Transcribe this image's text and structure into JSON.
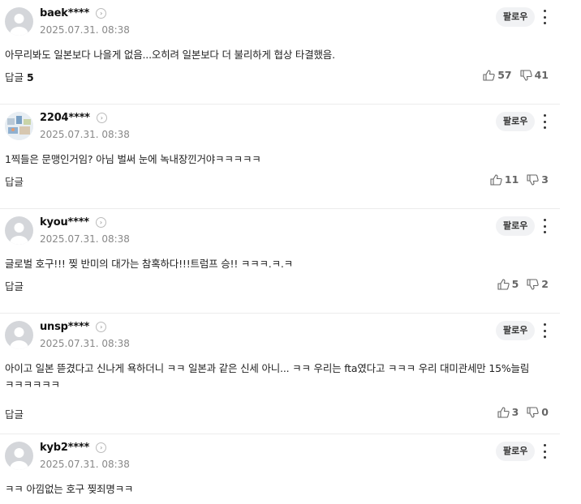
{
  "comments": [
    {
      "author": "baek****",
      "date": "2025.07.31. 08:38",
      "follow_label": "팔로우",
      "text": "아무리봐도 일본보다 나을게 없음...오히려 일본보다 더 불리하게 협상 타결했음.",
      "reply_label": "답글",
      "reply_count": "5",
      "likes": "57",
      "dislikes": "41"
    },
    {
      "author": "2204****",
      "date": "2025.07.31. 08:38",
      "follow_label": "팔로우",
      "text": "1찍들은 문맹인거임? 아님 벌써 눈에 녹내장낀거야ㅋㅋㅋㅋㅋ",
      "reply_label": "답글",
      "reply_count": "",
      "likes": "11",
      "dislikes": "3"
    },
    {
      "author": "kyou****",
      "date": "2025.07.31. 08:38",
      "follow_label": "팔로우",
      "text": "글로벌 호구!!! 찢 반미의 대가는 참혹하다!!!트럼프 승!! ㅋㅋㅋ.ㅋ.ㅋ",
      "reply_label": "답글",
      "reply_count": "",
      "likes": "5",
      "dislikes": "2"
    },
    {
      "author": "unsp****",
      "date": "2025.07.31. 08:38",
      "follow_label": "팔로우",
      "text": "아이고 일본 뜯겼다고 신나게 욕하더니 ㅋㅋ 일본과 같은 신세 아니... ㅋㅋ 우리는 fta였다고 ㅋㅋㅋ 우리 대미관세만 15%늘림ㅋㅋㅋㅋㅋㅋ",
      "reply_label": "답글",
      "reply_count": "",
      "likes": "3",
      "dislikes": "0"
    },
    {
      "author": "kyb2****",
      "date": "2025.07.31. 08:38",
      "follow_label": "팔로우",
      "text": "ㅋㅋ 아낌없는 호구 찢죄명ㅋㅋ"
    }
  ],
  "icons": {
    "more": "chevron-right-icon",
    "like": "thumbs-up-icon",
    "dislike": "thumbs-down-icon",
    "menu": "kebab-menu-icon"
  }
}
